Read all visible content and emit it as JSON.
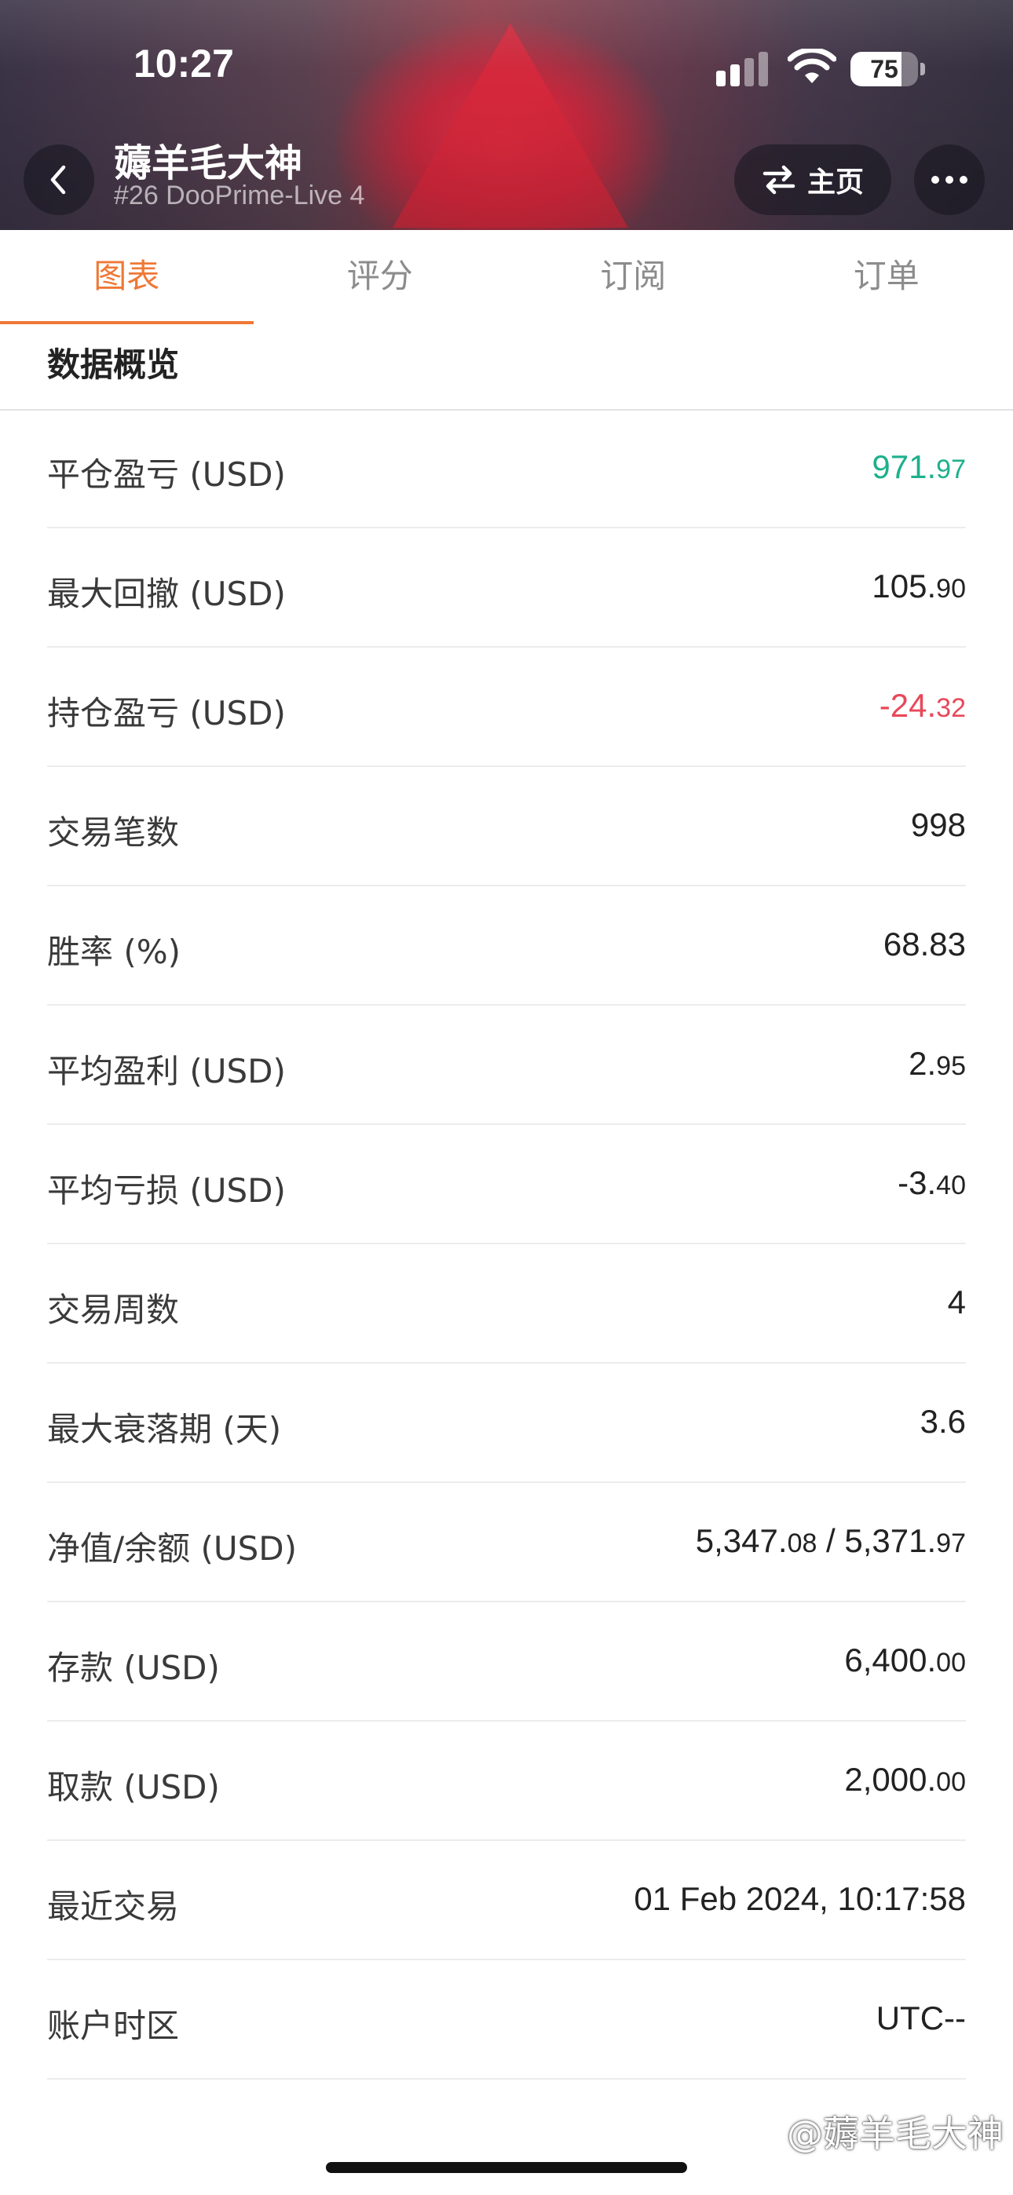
{
  "status_bar": {
    "time": "10:27",
    "battery_percent": "75",
    "battery_level": 0.75
  },
  "header": {
    "title": "薅羊毛大神",
    "subtitle": "#26 DooPrime-Live 4",
    "home_label": "主页",
    "icons": [
      "chevron-left-icon",
      "swap-icon",
      "more-icon"
    ]
  },
  "tabs": [
    {
      "label": "图表",
      "active": true
    },
    {
      "label": "评分",
      "active": false
    },
    {
      "label": "订阅",
      "active": false
    },
    {
      "label": "订单",
      "active": false
    }
  ],
  "section": {
    "title": "数据概览"
  },
  "rows": [
    {
      "label": "平仓盈亏 (USD)",
      "int": "971.",
      "dec": "97",
      "color": "#1eb08c"
    },
    {
      "label": "最大回撤 (USD)",
      "int": "105.",
      "dec": "90"
    },
    {
      "label": "持仓盈亏 (USD)",
      "int": "-24.",
      "dec": "32",
      "color": "#e8485a"
    },
    {
      "label": "交易笔数",
      "int": "998",
      "dec": ""
    },
    {
      "label": "胜率 (%)",
      "int": "68.83",
      "dec": ""
    },
    {
      "label": "平均盈利 (USD)",
      "int": "2.",
      "dec": "95"
    },
    {
      "label": "平均亏损 (USD)",
      "int": "-3.",
      "dec": "40"
    },
    {
      "label": "交易周数",
      "int": "4",
      "dec": ""
    },
    {
      "label": "最大衰落期 (天)",
      "int": "3.6",
      "dec": ""
    },
    {
      "label": "净值/余额 (USD)",
      "int": "5,347.",
      "dec": "08",
      "int2": " / 5,371.",
      "dec2": "97"
    },
    {
      "label": "存款 (USD)",
      "int": "6,400.",
      "dec": "00"
    },
    {
      "label": "取款 (USD)",
      "int": "2,000.",
      "dec": "00"
    },
    {
      "label": "最近交易",
      "int": "01 Feb 2024, 10:17:58",
      "dec": ""
    },
    {
      "label": "账户时区",
      "int": "UTC--",
      "dec": ""
    }
  ],
  "watermark": "@薅羊毛大神",
  "colors": {
    "accent": "#ef7836",
    "profit": "#1eb08c",
    "loss": "#e8485a"
  }
}
